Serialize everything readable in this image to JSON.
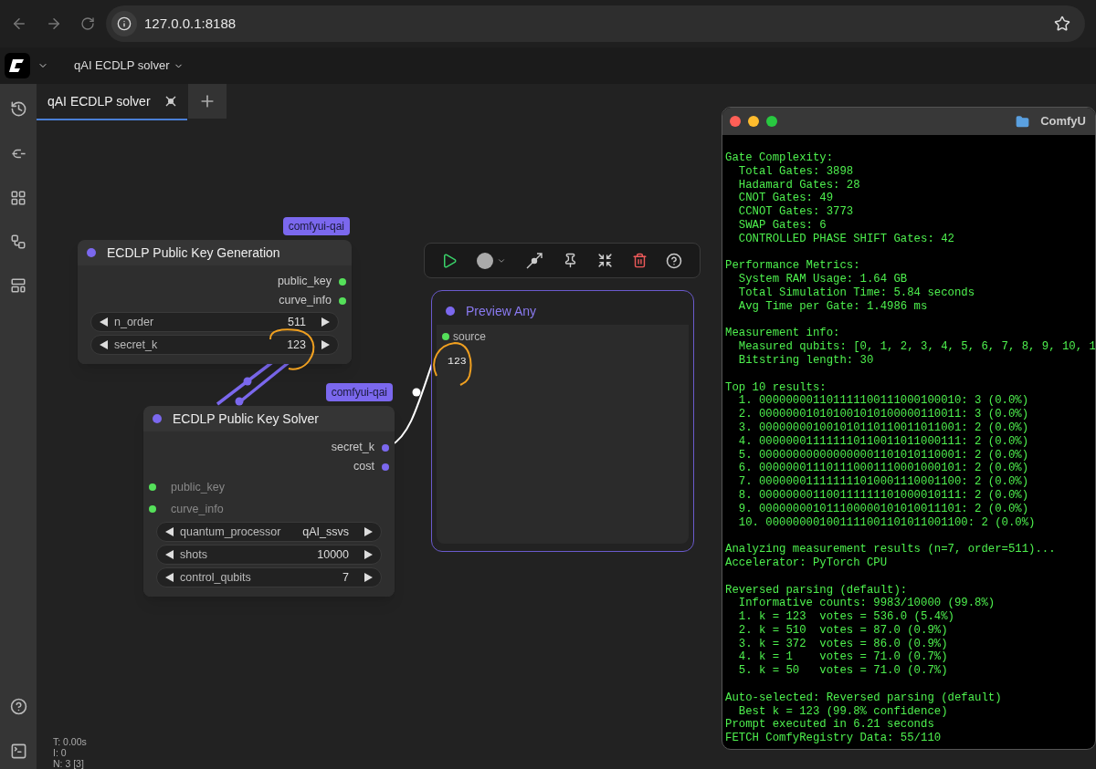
{
  "browser": {
    "url": "127.0.0.1:8188"
  },
  "app_header": {
    "workflow_menu": "qAI ECDLP solver"
  },
  "tabs": [
    {
      "label": "qAI ECDLP solver",
      "selected": true
    }
  ],
  "nodes": [
    {
      "kind": "generator",
      "title": "ECDLP Public Key Generation",
      "badge": "comfyui-qai",
      "outputs": [
        {
          "name": "public_key",
          "color": "#55e05a"
        },
        {
          "name": "curve_info",
          "color": "#55e05a"
        }
      ],
      "widgets": [
        {
          "label": "n_order",
          "value": "511"
        },
        {
          "label": "secret_k",
          "value": "123"
        }
      ]
    },
    {
      "kind": "solver",
      "title": "ECDLP Public Key Solver",
      "badge": "comfyui-qai",
      "outputs": [
        {
          "name": "secret_k",
          "color": "#7b68ee"
        },
        {
          "name": "cost",
          "color": "#7b68ee"
        }
      ],
      "inputs": [
        {
          "name": "public_key",
          "color": "#55e05a"
        },
        {
          "name": "curve_info",
          "color": "#55e05a"
        }
      ],
      "widgets": [
        {
          "label": "quantum_processor",
          "value": "qAI_ssvs"
        },
        {
          "label": "shots",
          "value": "10000"
        },
        {
          "label": "control_qubits",
          "value": "7"
        }
      ]
    },
    {
      "kind": "preview",
      "title": "Preview Any",
      "selected": true,
      "inputs": [
        {
          "name": "source",
          "color": "#55e05a"
        }
      ],
      "preview_text": "123"
    }
  ],
  "stats": [
    "T: 0.00s",
    "I: 0",
    "N: 3 [3]"
  ],
  "terminal": {
    "title": "ComfyU",
    "sections": [
      [
        "Gate Complexity:",
        "  Total Gates: 3898",
        "  Hadamard Gates: 28",
        "  CNOT Gates: 49",
        "  CCNOT Gates: 3773",
        "  SWAP Gates: 6",
        "  CONTROLLED PHASE SHIFT Gates: 42"
      ],
      [
        "Performance Metrics:",
        "  System RAM Usage: 1.64 GB",
        "  Total Simulation Time: 5.84 seconds",
        "  Avg Time per Gate: 1.4986 ms"
      ],
      [
        "Measurement info:",
        "  Measured qubits: [0, 1, 2, 3, 4, 5, 6, 7, 8, 9, 10, 1",
        "  Bitstring length: 30"
      ],
      [
        "Top 10 results:",
        "  1. 000000001101111100111000100010: 3 (0.0%)",
        "  2. 000000010101001010100000110011: 3 (0.0%)",
        "  3. 000000001001010110110011011001: 2 (0.0%)",
        "  4. 000000011111110110011011000111: 2 (0.0%)",
        "  5. 000000000000000001101010110001: 2 (0.0%)",
        "  6. 000000011101110001110001000101: 2 (0.0%)",
        "  7. 000000011111111010001110001100: 2 (0.0%)",
        "  8. 000000001100111111101000010111: 2 (0.0%)",
        "  9. 000000001011100000101010011101: 2 (0.0%)",
        "  10. 000000001001111001101011001100: 2 (0.0%)"
      ],
      [
        "Analyzing measurement results (n=7, order=511)...",
        "Accelerator: PyTorch CPU"
      ],
      [
        "Reversed parsing (default):",
        "  Informative counts: 9983/10000 (99.8%)",
        "  1. k = 123  votes = 536.0 (5.4%)",
        "  2. k = 510  votes = 87.0 (0.9%)",
        "  3. k = 372  votes = 86.0 (0.9%)",
        "  4. k = 1    votes = 71.0 (0.7%)",
        "  5. k = 50   votes = 71.0 (0.7%)"
      ],
      [
        "Auto-selected: Reversed parsing (default)",
        "  Best k = 123 (99.8% confidence)",
        "Prompt executed in 6.21 seconds",
        "FETCH ComfyRegistry Data: 55/110"
      ]
    ]
  }
}
